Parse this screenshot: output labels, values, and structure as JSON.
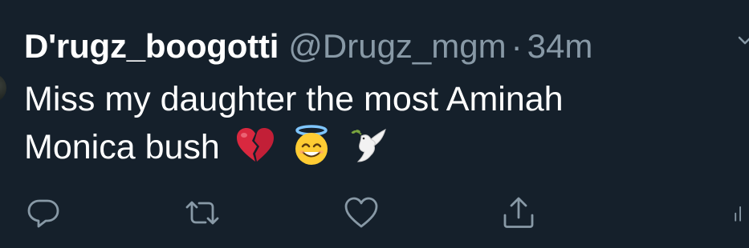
{
  "tweet": {
    "display_name": "D'rugz_boogotti",
    "handle": "@Drugz_mgm",
    "separator": "·",
    "time": "34m",
    "text_line1": "Miss my daughter the most Aminah",
    "text_line2": "Monica bush",
    "emojis": [
      "broken-heart",
      "smiling-face-with-halo",
      "dove"
    ]
  },
  "actions": {
    "reply_icon": "reply-icon",
    "retweet_icon": "retweet-icon",
    "like_icon": "heart-icon",
    "share_icon": "share-icon",
    "stats_icon": "analytics-icon"
  },
  "colors": {
    "background": "#15202b",
    "text": "#ffffff",
    "secondary": "#8899a6"
  }
}
